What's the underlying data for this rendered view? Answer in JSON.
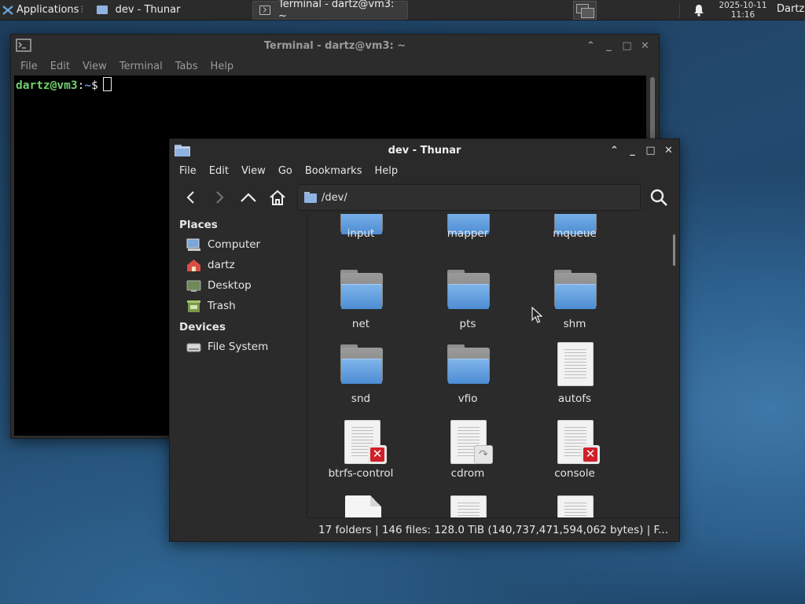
{
  "panel": {
    "applications_label": "Applications",
    "tasks": [
      {
        "label": "dev - Thunar",
        "icon": "folder-icon"
      },
      {
        "label": "Terminal - dartz@vm3: ~",
        "icon": "terminal-icon"
      }
    ],
    "clock_date": "2025-10-11",
    "clock_time": "11:16",
    "user": "Dartz"
  },
  "terminal": {
    "title": "Terminal - dartz@vm3: ~",
    "menu": [
      "File",
      "Edit",
      "View",
      "Terminal",
      "Tabs",
      "Help"
    ],
    "prompt_user": "dartz@vm3",
    "prompt_sep": ":",
    "prompt_path": "~",
    "prompt_dollar": "$"
  },
  "thunar": {
    "title": "dev - Thunar",
    "menu": [
      "File",
      "Edit",
      "View",
      "Go",
      "Bookmarks",
      "Help"
    ],
    "location": "/dev/",
    "sidebar": {
      "places_header": "Places",
      "places": [
        "Computer",
        "dartz",
        "Desktop",
        "Trash"
      ],
      "devices_header": "Devices",
      "devices": [
        "File System"
      ]
    },
    "items": [
      {
        "name": "input",
        "type": "folder"
      },
      {
        "name": "mapper",
        "type": "folder"
      },
      {
        "name": "mqueue",
        "type": "folder"
      },
      {
        "name": "net",
        "type": "folder"
      },
      {
        "name": "pts",
        "type": "folder"
      },
      {
        "name": "shm",
        "type": "folder"
      },
      {
        "name": "snd",
        "type": "folder"
      },
      {
        "name": "vfio",
        "type": "folder"
      },
      {
        "name": "autofs",
        "type": "file"
      },
      {
        "name": "btrfs-control",
        "type": "file-unreadable"
      },
      {
        "name": "cdrom",
        "type": "file-link"
      },
      {
        "name": "console",
        "type": "file-unreadable"
      }
    ],
    "status": "17 folders  |  146 files: 128.0 TiB (140,737,471,594,062 bytes)  |  F..."
  }
}
